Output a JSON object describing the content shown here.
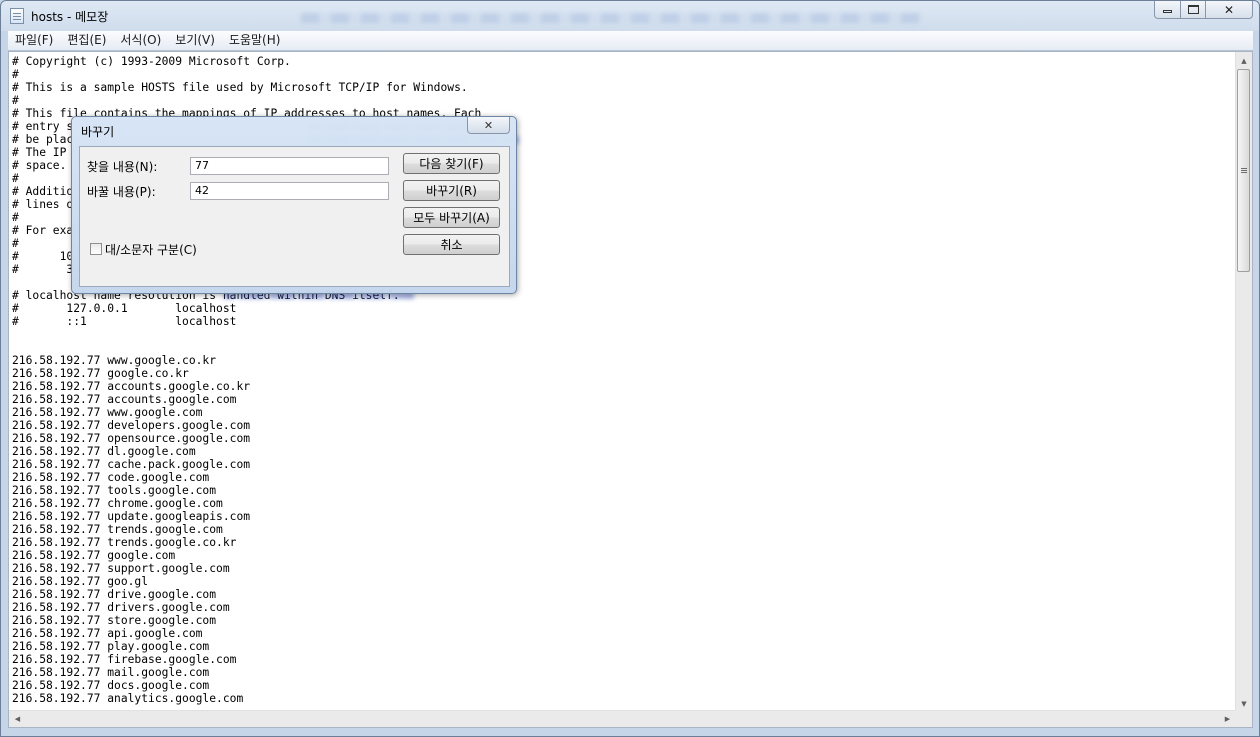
{
  "window": {
    "title": "hosts - 메모장",
    "caption_buttons": {
      "minimize": "minimize-icon",
      "maximize": "maximize-icon",
      "close": "close-icon"
    }
  },
  "menu": [
    "파일(F)",
    "편집(E)",
    "서식(O)",
    "보기(V)",
    "도움말(H)"
  ],
  "editor_lines": [
    "# Copyright (c) 1993-2009 Microsoft Corp.",
    "#",
    "# This is a sample HOSTS file used by Microsoft TCP/IP for Windows.",
    "#",
    "# This file contains the mappings of IP addresses to host names. Each",
    "# entry s",
    "# be plac",
    "# The IP",
    "# space.",
    "#",
    "# Additio",
    "# lines o",
    "#",
    "# For exa",
    "#",
    "#      10",
    "#       3",
    "",
    "# localhost name resolution is handled within DNS itself.",
    "#       127.0.0.1       localhost",
    "#       ::1             localhost",
    "",
    "",
    "216.58.192.77 www.google.co.kr",
    "216.58.192.77 google.co.kr",
    "216.58.192.77 accounts.google.co.kr",
    "216.58.192.77 accounts.google.com",
    "216.58.192.77 www.google.com",
    "216.58.192.77 developers.google.com",
    "216.58.192.77 opensource.google.com",
    "216.58.192.77 dl.google.com",
    "216.58.192.77 cache.pack.google.com",
    "216.58.192.77 code.google.com",
    "216.58.192.77 tools.google.com",
    "216.58.192.77 chrome.google.com",
    "216.58.192.77 update.googleapis.com",
    "216.58.192.77 trends.google.com",
    "216.58.192.77 trends.google.co.kr",
    "216.58.192.77 google.com",
    "216.58.192.77 support.google.com",
    "216.58.192.77 goo.gl",
    "216.58.192.77 drive.google.com",
    "216.58.192.77 drivers.google.com",
    "216.58.192.77 store.google.com",
    "216.58.192.77 api.google.com",
    "216.58.192.77 play.google.com",
    "216.58.192.77 firebase.google.com",
    "216.58.192.77 mail.google.com",
    "216.58.192.77 docs.google.com",
    "216.58.192.77 analytics.google.com"
  ],
  "replace_dialog": {
    "title": "바꾸기",
    "find_label": "찾을 내용(N):",
    "find_value": "77",
    "replace_label": "바꿀 내용(P):",
    "replace_value": "42",
    "find_next_button": "다음 찾기(F)",
    "replace_button": "바꾸기(R)",
    "replace_all_button": "모두 바꾸기(A)",
    "cancel_button": "취소",
    "match_case_label": "대/소문자 구분(C)",
    "match_case_checked": false
  }
}
